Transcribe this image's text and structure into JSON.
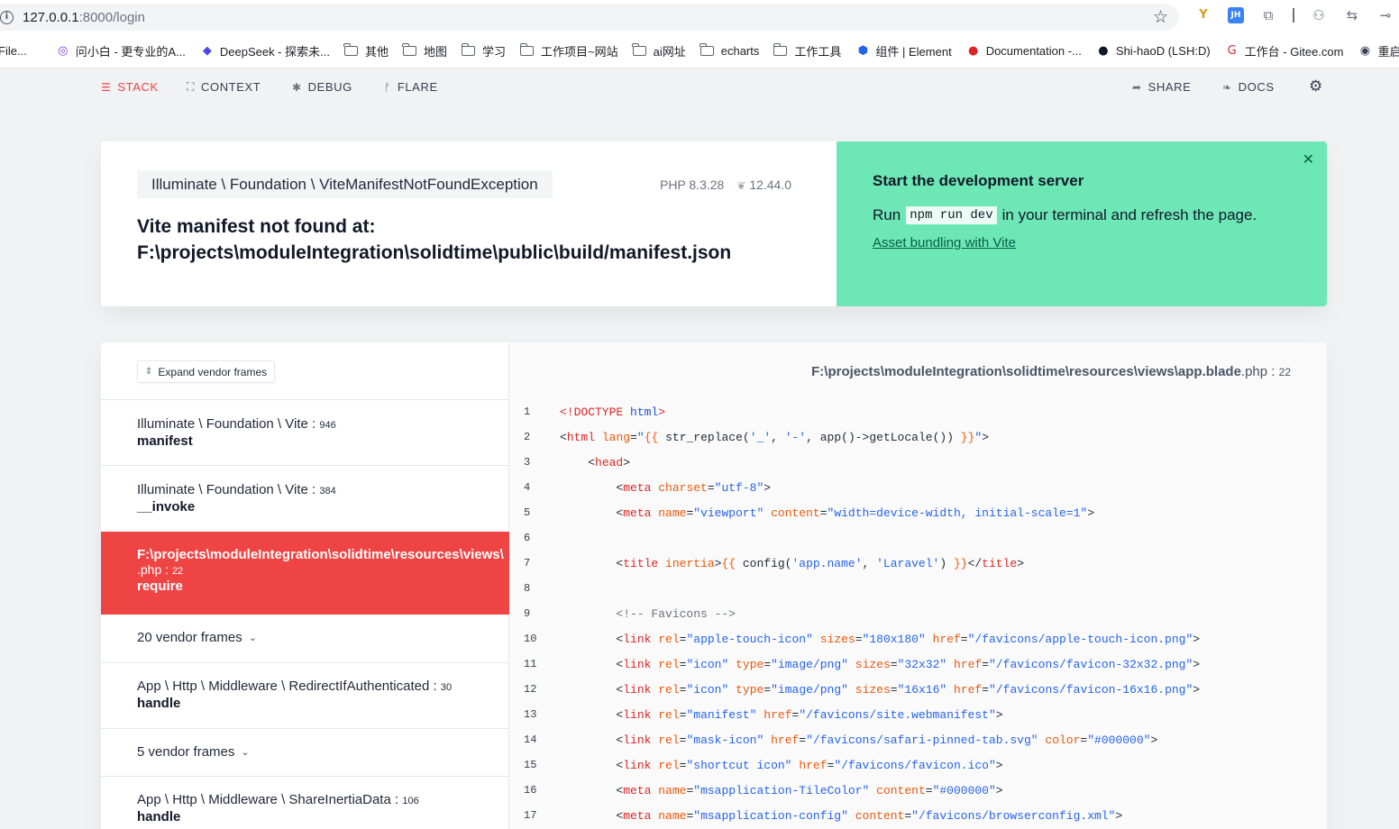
{
  "browser": {
    "url_host": "127.0.0.1",
    "url_path": ":8000/login",
    "bookmarks": [
      {
        "label": "File...",
        "icon": "file"
      },
      {
        "label": "问小白 - 更专业的A...",
        "icon": "chat-bubble"
      },
      {
        "label": "DeepSeek - 探索未...",
        "icon": "whale"
      },
      {
        "label": "其他",
        "icon": "folder"
      },
      {
        "label": "地图",
        "icon": "folder"
      },
      {
        "label": "学习",
        "icon": "folder"
      },
      {
        "label": "工作项目~网站",
        "icon": "folder"
      },
      {
        "label": "ai网址",
        "icon": "folder"
      },
      {
        "label": "echarts",
        "icon": "folder"
      },
      {
        "label": "工作工具",
        "icon": "folder"
      },
      {
        "label": "组件 | Element",
        "icon": "element"
      },
      {
        "label": "Documentation -...",
        "icon": "doc-circle"
      },
      {
        "label": "Shi-haoD (LSH:D)",
        "icon": "github"
      },
      {
        "label": "工作台 - Gitee.com",
        "icon": "gitee"
      },
      {
        "label": "重启chro",
        "icon": "globe"
      }
    ]
  },
  "nav": {
    "stack": "STACK",
    "context": "CONTEXT",
    "debug": "DEBUG",
    "flare": "FLARE",
    "share": "SHARE",
    "docs": "DOCS"
  },
  "error": {
    "exception_class": "Illuminate \\ Foundation \\ ViteManifestNotFoundException",
    "php_version": "PHP 8.3.28",
    "laravel_version": "12.44.0",
    "message_line1": "Vite manifest not found at:",
    "message_line2": "F:\\projects\\moduleIntegration\\solidtime\\public\\build/manifest.json"
  },
  "solution": {
    "title": "Start the development server",
    "body_before": "Run",
    "code": "npm run dev",
    "body_after": "in your terminal and refresh the page.",
    "link": "Asset bundling with Vite"
  },
  "stack": {
    "expand_label": "Expand vendor frames",
    "frames": [
      {
        "class": "Illuminate \\ Foundation \\ Vite",
        "line": "946",
        "method": "manifest"
      },
      {
        "class": "Illuminate \\ Foundation \\ Vite",
        "line": "384",
        "method": "__invoke"
      },
      {
        "class": "F:\\projects\\moduleIntegration\\solidtime\\resources\\views\\",
        "class2": ".php",
        "line": "22",
        "method": "require"
      },
      {
        "vendor": "20 vendor frames"
      },
      {
        "class": "App \\ Http \\ Middleware \\ RedirectIfAuthenticated",
        "line": "30",
        "method": "handle"
      },
      {
        "vendor": "5 vendor frames"
      },
      {
        "class": "App \\ Http \\ Middleware \\ ShareInertiaData",
        "line": "106",
        "method": "handle"
      }
    ]
  },
  "code": {
    "file_path": "F:\\projects\\moduleIntegration\\solidtime\\resources\\views\\app.blade",
    "file_ext": ".php",
    "file_line": "22",
    "line_numbers": [
      "1",
      "2",
      "3",
      "4",
      "5",
      "6",
      "7",
      "8",
      "9",
      "10",
      "11",
      "12",
      "13",
      "14",
      "15",
      "16",
      "17"
    ]
  }
}
